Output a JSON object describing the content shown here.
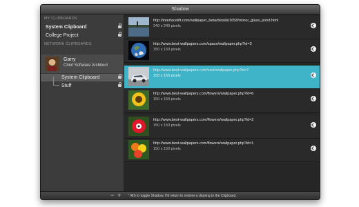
{
  "window": {
    "title": "Shadow"
  },
  "sidebar": {
    "my_clipboards_header": "MY CLIPBOARDS",
    "my_clipboards": [
      {
        "label": "System Clipboard"
      },
      {
        "label": "College Project"
      }
    ],
    "network_header": "NETWORK CLIPBOARDS",
    "user": {
      "name": "Garry",
      "role": "Chief Software Architect"
    },
    "network_items": [
      {
        "label": "System Clipboard"
      },
      {
        "label": "Stuff"
      }
    ],
    "toolbar": {
      "remove_label": "−",
      "add_label": "+"
    }
  },
  "clippings": [
    {
      "url": "http://interfacelift.com/wallpaper_beta/details/1658/mirror_glass_pond.html",
      "dims": "240 x 240 pixels",
      "thumb": "pond-thumbnail",
      "selected": false
    },
    {
      "url": "http://www.best-wallpapers.com/space/wallpaper.php?id=3",
      "dims": "150 x 150 pixels",
      "thumb": "earth-thumbnail",
      "selected": false
    },
    {
      "url": "http://www.best-wallpapers.com/cars/wallpaper.php?id=7",
      "dims": "150 x 150 pixels",
      "thumb": "car-thumbnail",
      "selected": true
    },
    {
      "url": "http://www.best-wallpapers.com/flowers/wallpaper.php?id=6",
      "dims": "150 x 150 pixels",
      "thumb": "sunflower-thumbnail",
      "selected": false
    },
    {
      "url": "http://www.best-wallpapers.com/flowers/wallpaper.php?id=2",
      "dims": "150 x 150 pixels",
      "thumb": "red-flower-thumbnail",
      "selected": false
    },
    {
      "url": "http://www.best-wallpapers.com/flowers/wallpaper.php?id=1",
      "dims": "150 x 150 pixels",
      "thumb": "flowers-thumbnail",
      "selected": false
    }
  ],
  "status": {
    "text": "⌃⌘S to toggle Shadow. Hit return to restore a clipping to the Clipboard."
  },
  "colors": {
    "selection": "#3fb3c7",
    "panel": "#262626",
    "sidebar": "#3c3c3c"
  }
}
